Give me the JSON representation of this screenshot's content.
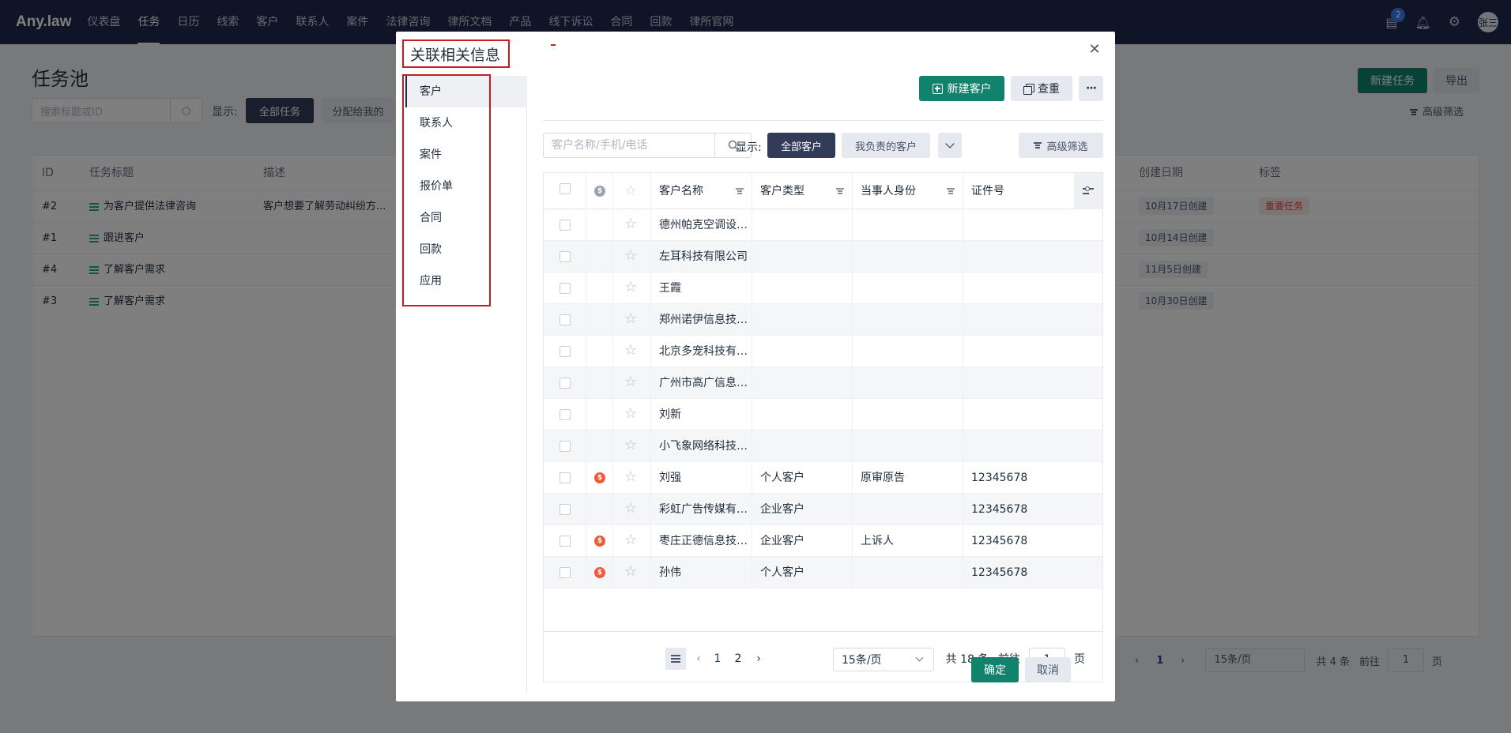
{
  "app": {
    "logo": "Any.law",
    "nav": [
      "仪表盘",
      "任务",
      "日历",
      "线索",
      "客户",
      "联系人",
      "案件",
      "法律咨询",
      "律所文档",
      "产品",
      "线下诉讼",
      "合同",
      "回款",
      "律所官网"
    ],
    "active_nav": "任务",
    "notification_count": "2",
    "avatar_text": "张三"
  },
  "background_page": {
    "title": "任务池",
    "new_task_label": "新建任务",
    "export_label": "导出",
    "search_placeholder": "搜索标题或ID",
    "show_label": "显示:",
    "filter_all": "全部任务",
    "filter_assigned": "分配给我的",
    "advanced_filter": "高级筛选",
    "columns": [
      "ID",
      "任务标题",
      "描述",
      "创建日期",
      "标签"
    ],
    "rows": [
      {
        "id": "#2",
        "title": "为客户提供法律咨询",
        "desc": "客户想要了解劳动纠纷方...",
        "date": "10月17日创建",
        "tag": "重要任务"
      },
      {
        "id": "#1",
        "title": "跟进客户",
        "desc": "",
        "date": "10月14日创建",
        "tag": ""
      },
      {
        "id": "#4",
        "title": "了解客户需求",
        "desc": "",
        "date": "11月5日创建",
        "tag": ""
      },
      {
        "id": "#3",
        "title": "了解客户需求",
        "desc": "",
        "date": "10月30日创建",
        "tag": ""
      }
    ],
    "pager": {
      "current": "1",
      "page_size": "15条/页",
      "total": "共 4 条",
      "goto_label": "前往",
      "goto_value": "1",
      "page_unit": "页"
    }
  },
  "modal": {
    "title": "关联相关信息",
    "menu": [
      "客户",
      "联系人",
      "案件",
      "报价单",
      "合同",
      "回款",
      "应用"
    ],
    "active_menu": "客户",
    "new_customer_label": "新建客户",
    "dedupe_label": "查重",
    "more_label": "···",
    "search_placeholder": "客户名称/手机/电话",
    "show_label": "显示:",
    "filter_all": "全部客户",
    "filter_mine": "我负责的客户",
    "advanced_filter": "高级筛选",
    "columns": {
      "name": "客户名称",
      "type": "客户类型",
      "party_role": "当事人身份",
      "id_no": "证件号"
    },
    "rows": [
      {
        "name": "德州帕克空调设备...",
        "type": "",
        "role": "",
        "id": "",
        "vip": false
      },
      {
        "name": "左耳科技有限公司",
        "type": "",
        "role": "",
        "id": "",
        "vip": false
      },
      {
        "name": "王霞",
        "type": "",
        "role": "",
        "id": "",
        "vip": false
      },
      {
        "name": "郑州诺伊信息技术...",
        "type": "",
        "role": "",
        "id": "",
        "vip": false
      },
      {
        "name": "北京多宠科技有限...",
        "type": "",
        "role": "",
        "id": "",
        "vip": false
      },
      {
        "name": "广州市高广信息技...",
        "type": "",
        "role": "",
        "id": "",
        "vip": false
      },
      {
        "name": "刘新",
        "type": "",
        "role": "",
        "id": "",
        "vip": false
      },
      {
        "name": "小飞象网络科技有...",
        "type": "",
        "role": "",
        "id": "",
        "vip": false
      },
      {
        "name": "刘强",
        "type": "个人客户",
        "role": "原审原告",
        "id": "12345678",
        "vip": true
      },
      {
        "name": "彩虹广告传媒有限...",
        "type": "企业客户",
        "role": "",
        "id": "12345678",
        "vip": false
      },
      {
        "name": "枣庄正德信息技术...",
        "type": "企业客户",
        "role": "上诉人",
        "id": "12345678",
        "vip": true
      },
      {
        "name": "孙伟",
        "type": "个人客户",
        "role": "",
        "id": "12345678",
        "vip": true
      }
    ],
    "pager": {
      "pages": [
        "1",
        "2"
      ],
      "current": "1",
      "page_size": "15条/页",
      "total": "共 18 条",
      "goto_label": "前往",
      "goto_value": "1",
      "page_unit": "页"
    },
    "confirm_label": "确定",
    "cancel_label": "取消"
  },
  "colors": {
    "nav_bg": "#1e2a4d",
    "primary": "#11826b",
    "dark_button": "#323c59",
    "highlight_box": "#c81d1d",
    "vip": "#ee5a3a"
  }
}
